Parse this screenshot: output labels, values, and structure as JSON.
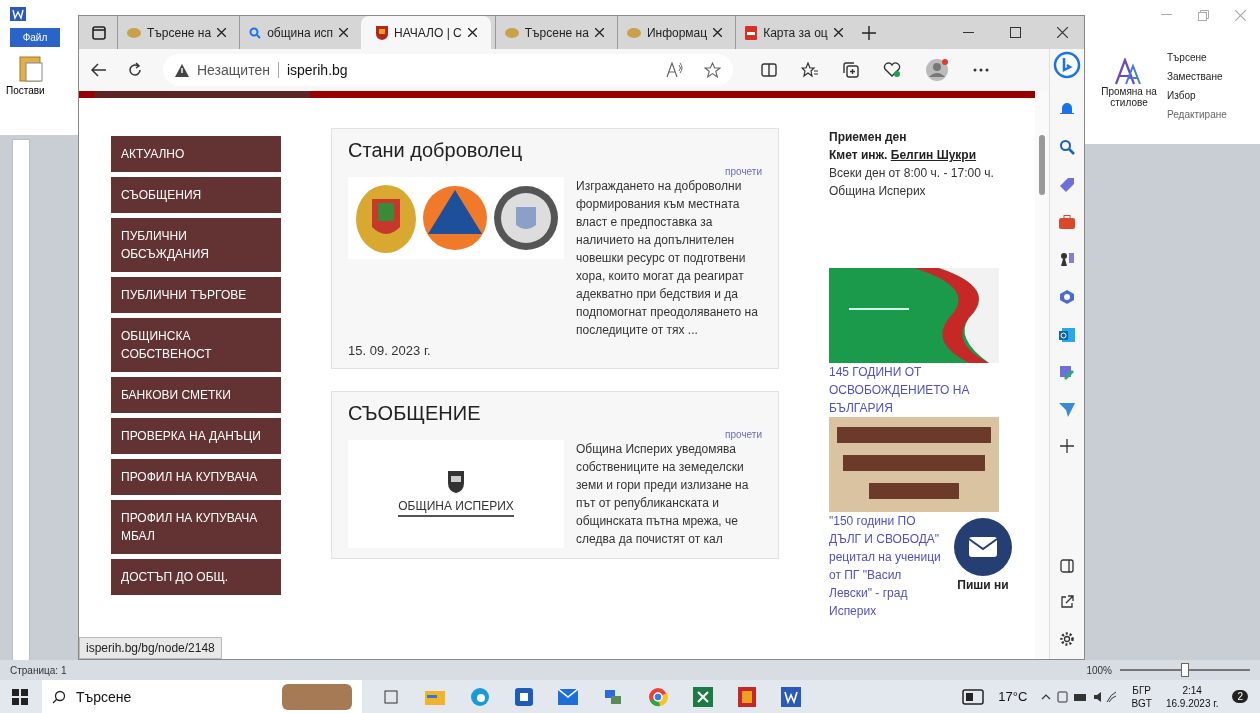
{
  "word_left": {
    "file_tab": "Файл",
    "paste": "Постави"
  },
  "word_right": {
    "styles": "Промяна на стилове",
    "find": "Търсене",
    "replace": "Заместване",
    "select": "Избор",
    "group": "Редактиране"
  },
  "browser": {
    "tabs": [
      {
        "title": "Търсене на",
        "kind": "flag",
        "selected": false
      },
      {
        "title": "община исп",
        "kind": "search",
        "selected": false
      },
      {
        "title": "НАЧАЛО | С",
        "kind": "crest",
        "selected": true
      },
      {
        "title": "Търсене на",
        "kind": "flag",
        "selected": false
      },
      {
        "title": "Информац",
        "kind": "flag",
        "selected": false
      },
      {
        "title": "Карта за оц",
        "kind": "pdf",
        "selected": false
      }
    ],
    "security": "Незащитен",
    "url": "isperih.bg",
    "status_url": "isperih.bg/bg/node/2148"
  },
  "nav": [
    "АКТУАЛНО",
    "СЪОБЩЕНИЯ",
    "ПУБЛИЧНИ ОБСЪЖДАНИЯ",
    "ПУБЛИЧНИ ТЪРГОВЕ",
    "ОБЩИНСКА СОБСТВЕНОСТ",
    "БАНКОВИ СМЕТКИ",
    "ПРОВЕРКА НА ДАНЪЦИ",
    "ПРОФИЛ НА КУПУВАЧА",
    "ПРОФИЛ НА КУПУВАЧА МБАЛ",
    "ДОСТЪП ДО ОБЩ."
  ],
  "articles": [
    {
      "kind": "emblems",
      "title": "Стани доброволец",
      "read_more": "прочети",
      "text": "Изграждането на доброволни формирования към местната власт е предпоставка за наличието на допълнителен човешки ресурс от подготвени хора, които могат да реагират адекватно при бедствия и да подпомогнат преодоляването на последиците от тях ...",
      "date": "15. 09. 2023 г."
    },
    {
      "kind": "logo",
      "title": "СЪОБЩЕНИЕ",
      "read_more": "прочети",
      "logo_text": "ОБЩИНА ИСПЕРИХ",
      "text": "Община Исперих уведомява собствениците на земеделски земи и гори преди излизане на път от републиканската и общинската пътна мрежа, че следва да почистят от кал"
    }
  ],
  "reception": {
    "title": "Приемен ден",
    "mayor_label": "Кмет инж.",
    "mayor_name": "Белгин Шукри",
    "hours": "Всеки ден от 8:00 ч. - 17:00 ч.",
    "place": "Община Исперих"
  },
  "banners": [
    {
      "kind": "green",
      "link": "145 ГОДИНИ ОТ ОСВОБОЖДЕНИЕТО НА БЪЛГАРИЯ"
    },
    {
      "kind": "parchment",
      "link": "\"150 години ПО ДЪЛГ И СВОБОДА\" рецитал на ученици от ПГ \"Васил Левски\" - град Исперих"
    }
  ],
  "contact_button": "Пиши ни",
  "word_status": {
    "page": "Страница: 1",
    "zoom": "100%",
    "level": 0.5
  },
  "taskbar": {
    "search": "Търсене",
    "temperature": "17°C",
    "language": "БГР",
    "timezone": "BGT",
    "time": "2:14",
    "date": "16.9.2023 г.",
    "notifications": "2"
  }
}
